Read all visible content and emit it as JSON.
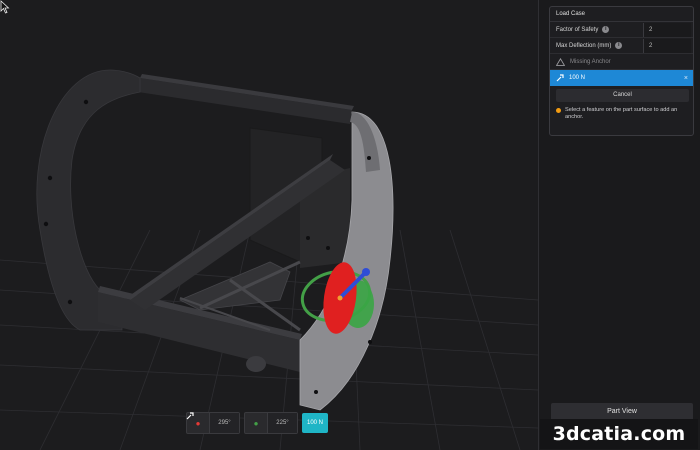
{
  "load_case": {
    "title": "Load Case",
    "fields": [
      {
        "label": "Factor of Safety",
        "value": "2"
      },
      {
        "label": "Max Deflection (mm)",
        "value": "2"
      }
    ],
    "missing_anchor": "Missing Anchor",
    "force_item": "100 N",
    "cancel_label": "Cancel",
    "hint": "Select a feature on the part surface to add an anchor."
  },
  "part_view_label": "Part View",
  "rotation": {
    "x_value": "295°",
    "y_value": "225°",
    "force_value": "100 N"
  },
  "watermark": "3dcatia.com",
  "colors": {
    "accent_blue": "#1e88d6",
    "force_teal": "#1fb5c6",
    "warning": "#f39c12",
    "gizmo_red": "#e53935",
    "gizmo_green": "#43a047",
    "gizmo_blue": "#2f4dd6"
  },
  "icons": {
    "info": "info-icon",
    "missing_anchor": "warning-triangle-icon",
    "force": "force-arrow-icon",
    "close": "close-icon",
    "hint": "warning-dot-icon",
    "cursor": "mouse-cursor-icon"
  }
}
